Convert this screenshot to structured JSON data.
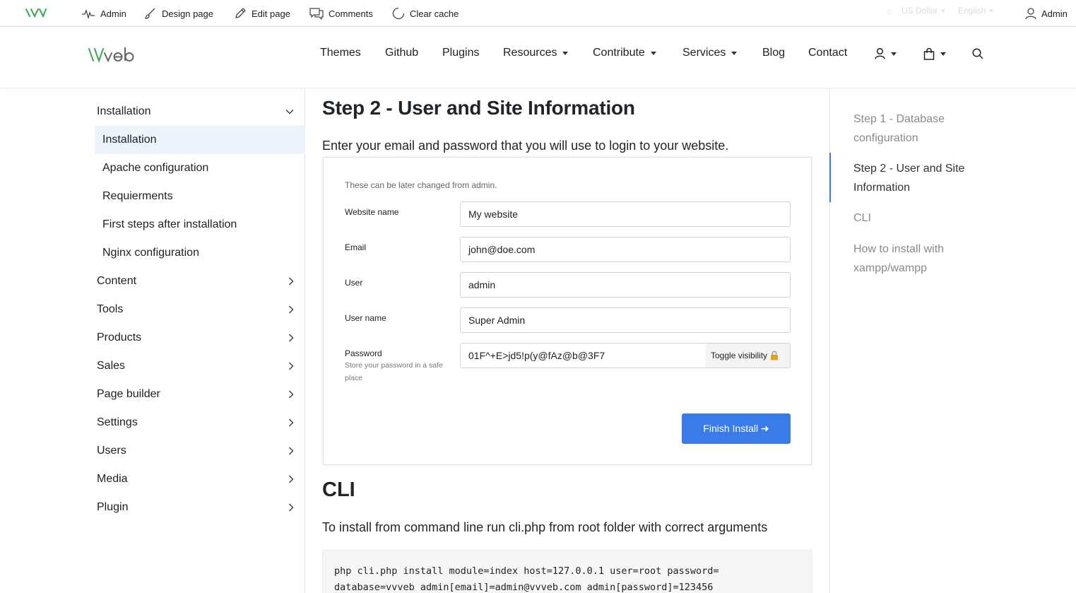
{
  "adminbar": {
    "items": [
      {
        "label": "Admin",
        "icon": "activity-icon"
      },
      {
        "label": "Design page",
        "icon": "brush-icon"
      },
      {
        "label": "Edit page",
        "icon": "pencil-icon"
      },
      {
        "label": "Comments",
        "icon": "comments-icon"
      },
      {
        "label": "Clear cache",
        "icon": "refresh-icon"
      }
    ],
    "currency": "US Dollar",
    "language": "English",
    "user": "Admin"
  },
  "nav": {
    "links": [
      {
        "label": "Themes"
      },
      {
        "label": "Github"
      },
      {
        "label": "Plugins"
      },
      {
        "label": "Resources"
      },
      {
        "label": "Contribute"
      },
      {
        "label": "Services"
      },
      {
        "label": "Blog"
      },
      {
        "label": "Contact"
      }
    ]
  },
  "sidebar": {
    "group": "Installation",
    "subitems": [
      {
        "label": "Installation",
        "active": true
      },
      {
        "label": "Apache configuration"
      },
      {
        "label": "Requierments"
      },
      {
        "label": "First steps after installation"
      },
      {
        "label": "Nginx configuration"
      }
    ],
    "items": [
      {
        "label": "Content"
      },
      {
        "label": "Tools"
      },
      {
        "label": "Products"
      },
      {
        "label": "Sales"
      },
      {
        "label": "Page builder"
      },
      {
        "label": "Settings"
      },
      {
        "label": "Users"
      },
      {
        "label": "Media"
      },
      {
        "label": "Plugin"
      }
    ]
  },
  "content": {
    "heading": "Step 2 - User and Site Information",
    "lead": "Enter your email and password that you will use to login to your website.",
    "form": {
      "note": "These can be later changed from admin.",
      "fields": [
        {
          "label": "Website name",
          "value": "My website"
        },
        {
          "label": "Email",
          "value": "john@doe.com"
        },
        {
          "label": "User",
          "value": "admin"
        },
        {
          "label": "User name",
          "value": "Super Admin"
        }
      ],
      "password": {
        "label": "Password",
        "help": "Store your password in a safe place",
        "value": "01F^+E>jd5!p(y@fAz@b@3F7",
        "toggle": "Toggle visibility"
      },
      "submit": "Finish Install ➜"
    },
    "cli_heading": "CLI",
    "cli_text": "To install from command line run cli.php from root folder with correct arguments",
    "code": "php cli.php install module=index host=127.0.0.1 user=root password=\ndatabase=vvveb admin[email]=admin@vvveb.com admin[password]=123456"
  },
  "toc": {
    "items": [
      {
        "label": "Step 1 - Database configuration"
      },
      {
        "label": "Step 2 - User and Site Information",
        "active": true
      },
      {
        "label": "CLI"
      },
      {
        "label": "How to install with xampp/wampp"
      }
    ]
  },
  "colors": {
    "accent": "#3a7bea",
    "logo_green": "#3aa655",
    "active_bg": "#eef4fb"
  }
}
